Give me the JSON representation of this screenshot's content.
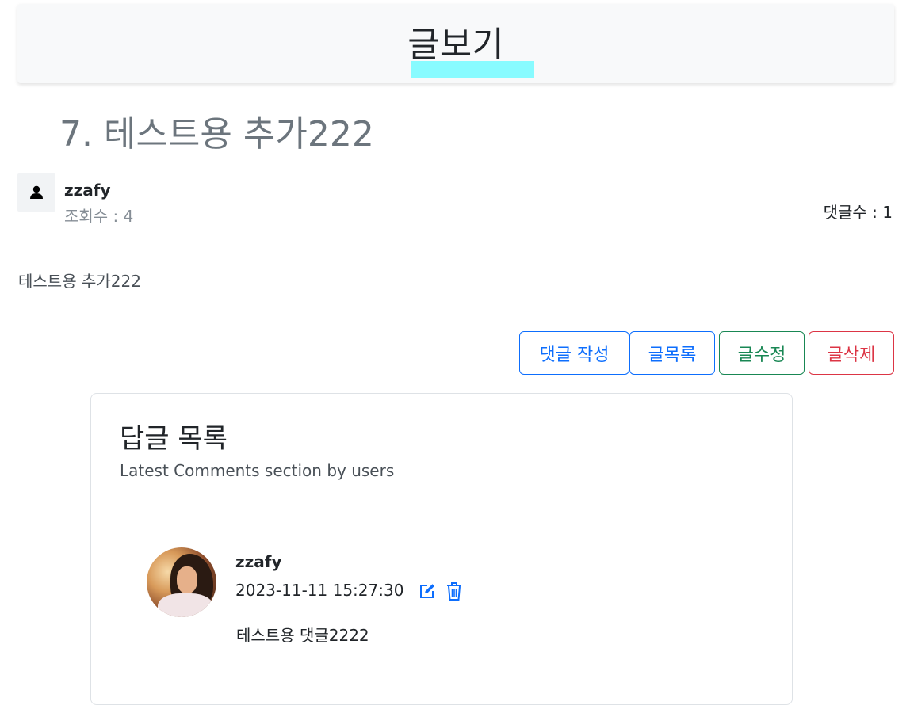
{
  "header": {
    "title": "글보기"
  },
  "post": {
    "title": "7. 테스트용 추가222",
    "author": "zzafy",
    "views": "조회수 : 4",
    "comment_count": "댓글수 : 1",
    "body": "테스트용 추가222"
  },
  "actions": {
    "write_comment": "댓글 작성",
    "list": "글목록",
    "edit": "글수정",
    "delete": "글삭제"
  },
  "comments_section": {
    "title": "답글 목록",
    "subtitle": "Latest Comments section by users",
    "items": [
      {
        "author": "zzafy",
        "date": "2023-11-11 15:27:30",
        "text": "테스트용 댓글2222"
      }
    ]
  },
  "colors": {
    "primary": "#0d6efd",
    "success": "#198754",
    "danger": "#dc3545",
    "highlight": "#88fbff"
  },
  "icons": [
    "user-icon",
    "edit-icon",
    "trash-icon"
  ]
}
